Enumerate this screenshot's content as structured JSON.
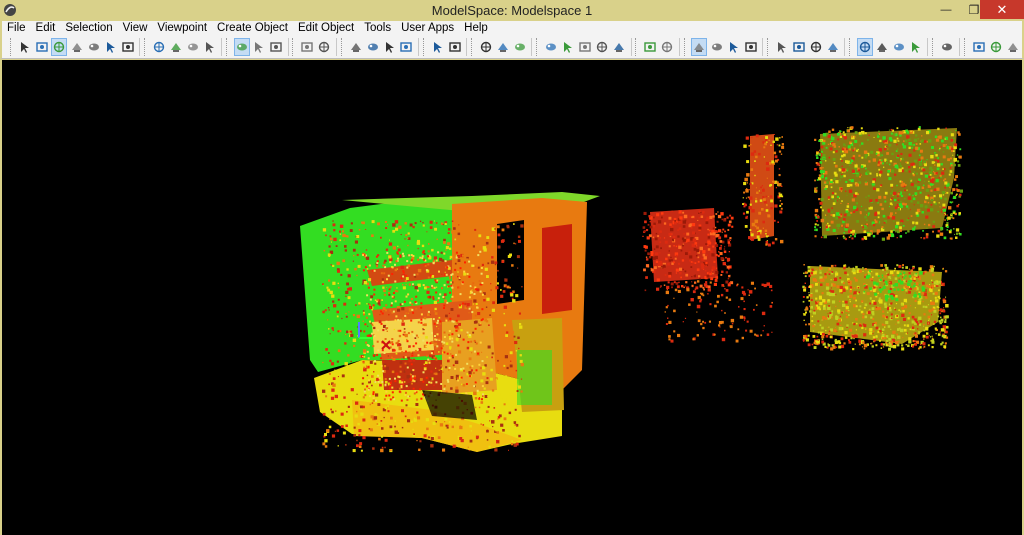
{
  "window": {
    "title": "ModelSpace: Modelspace 1",
    "minimize_glyph": "—",
    "restore_glyph": "❐",
    "close_glyph": "✕"
  },
  "menu": [
    {
      "label": "File"
    },
    {
      "label": "Edit"
    },
    {
      "label": "Selection"
    },
    {
      "label": "View"
    },
    {
      "label": "Viewpoint"
    },
    {
      "label": "Create Object"
    },
    {
      "label": "Edit Object"
    },
    {
      "label": "Tools"
    },
    {
      "label": "User Apps"
    },
    {
      "label": "Help"
    }
  ],
  "toolbar_groups": [
    [
      "select-arrow-icon",
      "select-plus-icon",
      "pan-hand-icon",
      "pencil-icon",
      "move-icon",
      "orbit-icon",
      "rotate-icon"
    ],
    [
      "fence-icon",
      "rectangle-icon",
      "circle-icon",
      "polygon-icon"
    ],
    [
      "box-view-icon",
      "cube-icon",
      "node-icon"
    ],
    [
      "points-icon",
      "fit-icon"
    ],
    [
      "zoom-in-icon",
      "zoom-out-icon",
      "zoom-window-icon",
      "zoom-extents-icon"
    ],
    [
      "add-layer-icon",
      "merge-icon"
    ],
    [
      "cloud-a-icon",
      "cloud-b-icon",
      "cloud-c-icon"
    ],
    [
      "copy-icon",
      "paste-icon",
      "measure-icon",
      "pipe-icon",
      "cone-icon"
    ],
    [
      "layers-icon",
      "layer-select-icon"
    ],
    [
      "person-icon",
      "scan-icon",
      "globe-icon",
      "pointer-icon"
    ],
    [
      "view-front-icon",
      "view-side-icon",
      "view-top-icon",
      "view-iso-icon"
    ],
    [
      "render-a-icon",
      "render-b-icon",
      "render-c-icon",
      "render-d-icon"
    ],
    [
      "grab-icon"
    ],
    [
      "undo-icon",
      "redo-icon",
      "settings-icon"
    ]
  ],
  "toolbar_active": [
    "pan-hand-icon",
    "box-view-icon",
    "person-icon",
    "render-a-icon"
  ],
  "colors": {
    "frame": "#d9d18a",
    "viewport_bg": "#000000",
    "close_button": "#c7382b",
    "point_green": "#33dd22",
    "point_yellow": "#e8dd10",
    "point_orange": "#e87a10",
    "point_red": "#dd2a10"
  }
}
